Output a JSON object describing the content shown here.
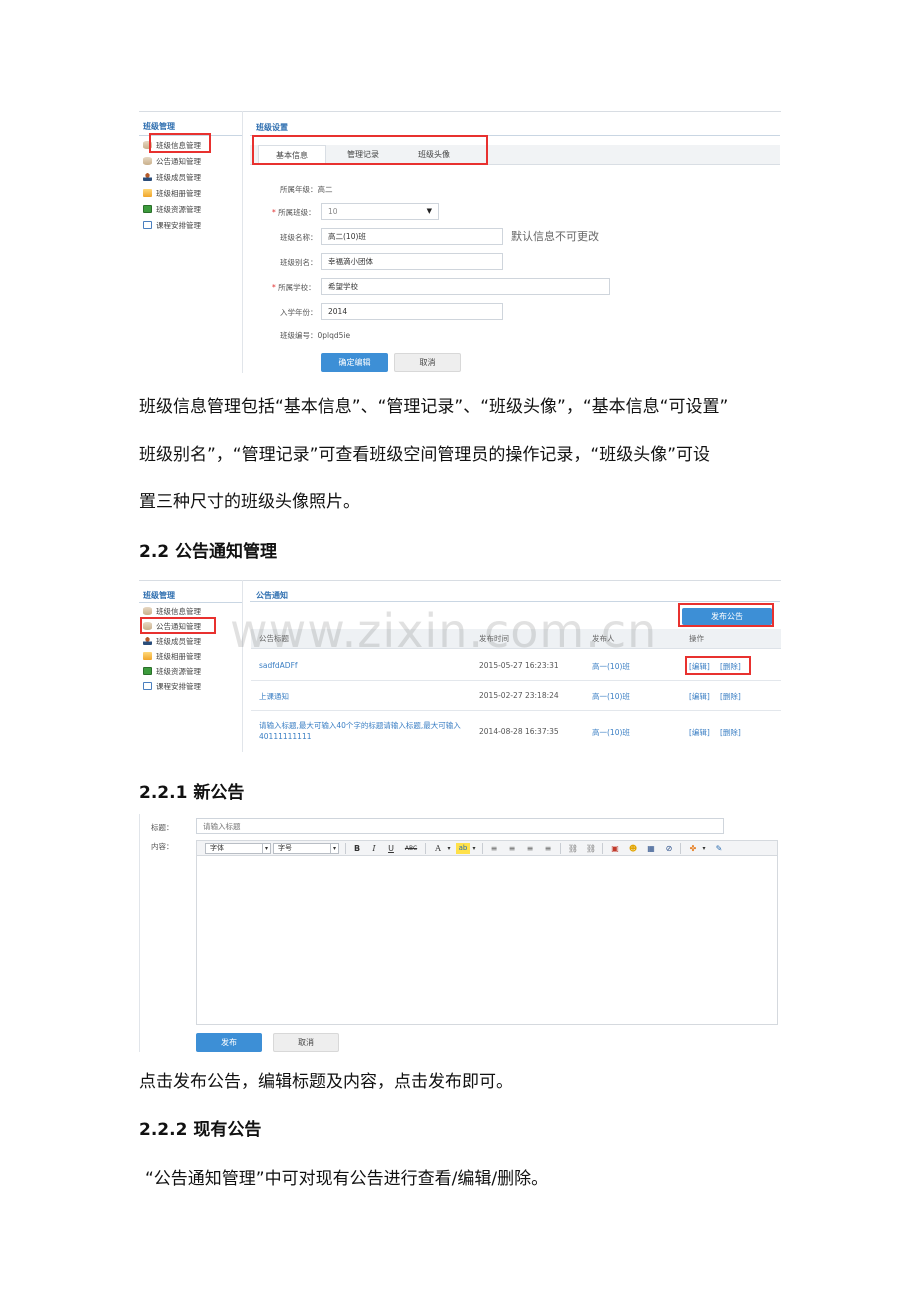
{
  "sidebar": {
    "title": "班级管理",
    "items": [
      {
        "label": "班级信息管理",
        "icon": "database-icon"
      },
      {
        "label": "公告通知管理",
        "icon": "database-icon"
      },
      {
        "label": "班级成员管理",
        "icon": "person-icon"
      },
      {
        "label": "班级相册管理",
        "icon": "album-icon"
      },
      {
        "label": "班级资源管理",
        "icon": "resource-icon"
      },
      {
        "label": "课程安排管理",
        "icon": "schedule-icon"
      }
    ]
  },
  "panel1": {
    "section_title": "班级设置",
    "tabs": [
      "基本信息",
      "管理记录",
      "班级头像"
    ],
    "fields": {
      "grade_label": "所属年级：",
      "grade_value": "高二",
      "class_label": "所属班级：",
      "class_value": "10",
      "name_label": "班级名称：",
      "name_value": "高二(10)班",
      "default_note": "默认信息不可更改",
      "alias_label": "班级别名：",
      "alias_value": "幸福滴小团体",
      "school_label": "所属学校：",
      "school_value": "希望学校",
      "year_label": "入学年份：",
      "year_value": "2014",
      "code_label": "班级编号：",
      "code_value": "0plqd5ie"
    },
    "confirm_label": "确定编辑",
    "cancel_label": "取消"
  },
  "text": {
    "para1_line1": "班级信息管理包括“基本信息”、“管理记录”、“班级头像”，“基本信息“可设置”",
    "para1_line2": "班级别名”，“管理记录”可查看班级空间管理员的操作记录，“班级头像”可设",
    "para1_line3": "置三种尺寸的班级头像照片。",
    "heading_22": "2.2  公告通知管理",
    "heading_221": "2.2.1  新公告",
    "para2": "点击发布公告，编辑标题及内容，点击发布即可。",
    "heading_222": "2.2.2  现有公告",
    "para3": "“公告通知管理”中可对现有公告进行查看/编辑/删除。",
    "watermark": "www.zixin.com.cn"
  },
  "panel2": {
    "section_title": "公告通知",
    "publish_label": "发布公告",
    "columns": [
      "公告标题",
      "发布时间",
      "发布人",
      "操作"
    ],
    "rows": [
      {
        "title": "sadfdADFf",
        "time": "2015-05-27 16:23:31",
        "publisher": "高一(10)班",
        "edit": "[编辑]",
        "delete": "[删除]"
      },
      {
        "title": "上课通知",
        "time": "2015-02-27 23:18:24",
        "publisher": "高一(10)班",
        "edit": "[编辑]",
        "delete": "[删除]"
      },
      {
        "title": "请输入标题,最大可输入40个字的标题请输入标题,最大可输入40111111111",
        "time": "2014-08-28 16:37:35",
        "publisher": "高一(10)班",
        "edit": "[编辑]",
        "delete": "[删除]"
      }
    ]
  },
  "panel3": {
    "title_label": "标题：",
    "title_placeholder": "请输入标题",
    "content_label": "内容：",
    "font_select": "字体",
    "size_select": "字号",
    "toolbar": {
      "bold": "B",
      "italic": "I",
      "underline": "U",
      "strike": "ABC",
      "font_color": "A",
      "highlight": "ab"
    },
    "publish_label": "发布",
    "cancel_label": "取消"
  },
  "colors": {
    "accent": "#3d8fd6",
    "highlight_box": "#e8312f",
    "link": "#3b7fc4"
  }
}
